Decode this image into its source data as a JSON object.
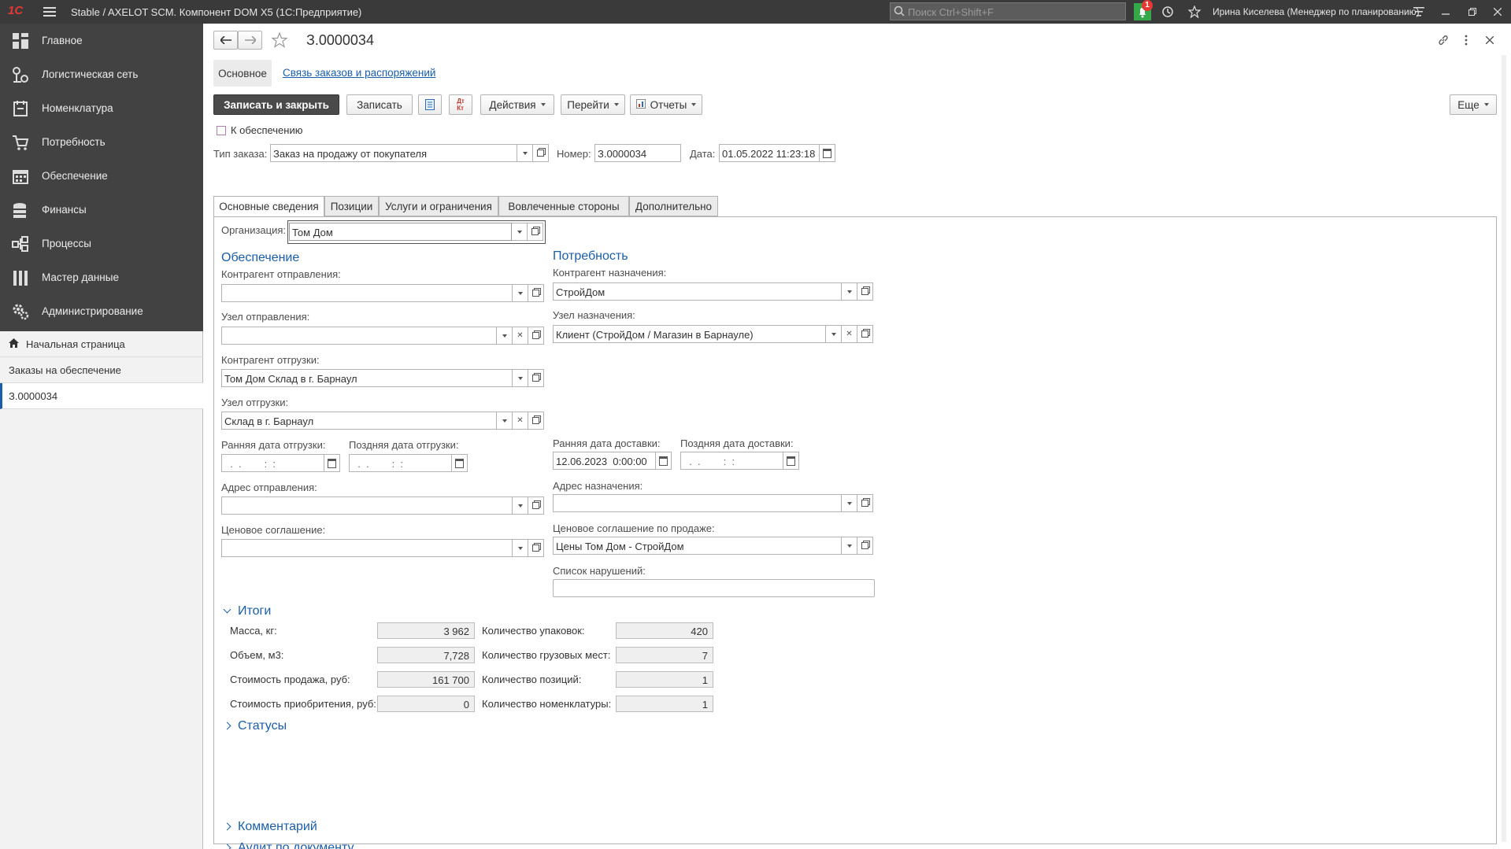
{
  "titlebar": {
    "title": "Stable / AXELOT SCM. Компонент DOM X5  (1С:Предприятие)",
    "search_placeholder": "Поиск Ctrl+Shift+F",
    "notification_count": "1",
    "user": "Ирина Киселева (Менеджер по планированию)"
  },
  "sidebar": {
    "sections": [
      "Главное",
      "Логистическая сеть",
      "Номенклатура",
      "Потребность",
      "Обеспечение",
      "Финансы",
      "Процессы",
      "Мастер данные",
      "Администрирование"
    ],
    "history": [
      "Начальная страница",
      "Заказы на обеспечение",
      "З.0000034"
    ]
  },
  "form": {
    "title": "З.0000034",
    "nav_tabs": [
      "Основное",
      "Связь заказов и распоряжений"
    ],
    "toolbar": {
      "save_close": "Записать и закрыть",
      "save": "Записать",
      "actions": "Действия",
      "goto": "Перейти",
      "reports": "Отчеты",
      "more": "Еще"
    },
    "for_supply_label": "К обеспечению",
    "order_type_label": "Тип заказа:",
    "order_type_value": "Заказ на продажу от покупателя",
    "number_label": "Номер:",
    "number_value": "З.0000034",
    "date_label": "Дата:",
    "date_value": "01.05.2022 11:23:18",
    "tabs": [
      "Основные сведения",
      "Позиции",
      "Услуги и ограничения",
      "Вовлеченные стороны",
      "Дополнительно"
    ],
    "org_label": "Организация:",
    "org_value": "Том Дом",
    "supply": {
      "header": "Обеспечение",
      "counterparty_from_label": "Контрагент отправления:",
      "counterparty_from_value": "",
      "node_from_label": "Узел отправления:",
      "node_from_value": "",
      "counterparty_ship_label": "Контрагент отгрузки:",
      "counterparty_ship_value": "Том Дом Склад в г. Барнаул",
      "node_ship_label": "Узел отгрузки:",
      "node_ship_value": "Склад в г. Барнаул",
      "early_ship_label": "Ранняя дата отгрузки:",
      "early_ship_value": "  .  .        :  :",
      "late_ship_label": "Поздняя дата отгрузки:",
      "late_ship_value": "  .  .        :  :",
      "address_from_label": "Адрес отправления:",
      "address_from_value": "",
      "price_agreement_label": "Ценовое соглашение:",
      "price_agreement_value": ""
    },
    "demand": {
      "header": "Потребность",
      "counterparty_to_label": "Контрагент назначения:",
      "counterparty_to_value": "СтройДом",
      "node_to_label": "Узел назначения:",
      "node_to_value": "Клиент (СтройДом / Магазин в Барнауле)",
      "early_delivery_label": "Ранняя дата доставки:",
      "early_delivery_value": "12.06.2023  0:00:00",
      "late_delivery_label": "Поздняя дата доставки:",
      "late_delivery_value": "  .  .        :  :",
      "address_to_label": "Адрес назначения:",
      "address_to_value": "",
      "sales_agreement_label": "Ценовое соглашение по продаже:",
      "sales_agreement_value": "Цены Том Дом - СтройДом",
      "violations_label": "Список нарушений:",
      "violations_value": ""
    },
    "totals": {
      "header": "Итоги",
      "rows_left": [
        {
          "label": "Масса, кг:",
          "value": "3 962"
        },
        {
          "label": "Объем, м3:",
          "value": "7,728"
        },
        {
          "label": "Стоимость продажа, руб:",
          "value": "161 700"
        },
        {
          "label": "Стоимость приобритения, руб:",
          "value": "0"
        }
      ],
      "rows_right": [
        {
          "label": "Количество упаковок:",
          "value": "420"
        },
        {
          "label": "Количество грузовых мест:",
          "value": "7"
        },
        {
          "label": "Количество позиций:",
          "value": "1"
        },
        {
          "label": "Количество номенклатуры:",
          "value": "1"
        }
      ]
    },
    "collapsed_groups": [
      "Статусы",
      "Комментарий",
      "Аудит по документу"
    ]
  },
  "colors": {
    "accent_blue": "#1a5eaa",
    "titlebar": "#3a3a3a",
    "sidebar_dark": "#424242",
    "notification_green": "#35a849",
    "notification_red": "#e53935"
  }
}
